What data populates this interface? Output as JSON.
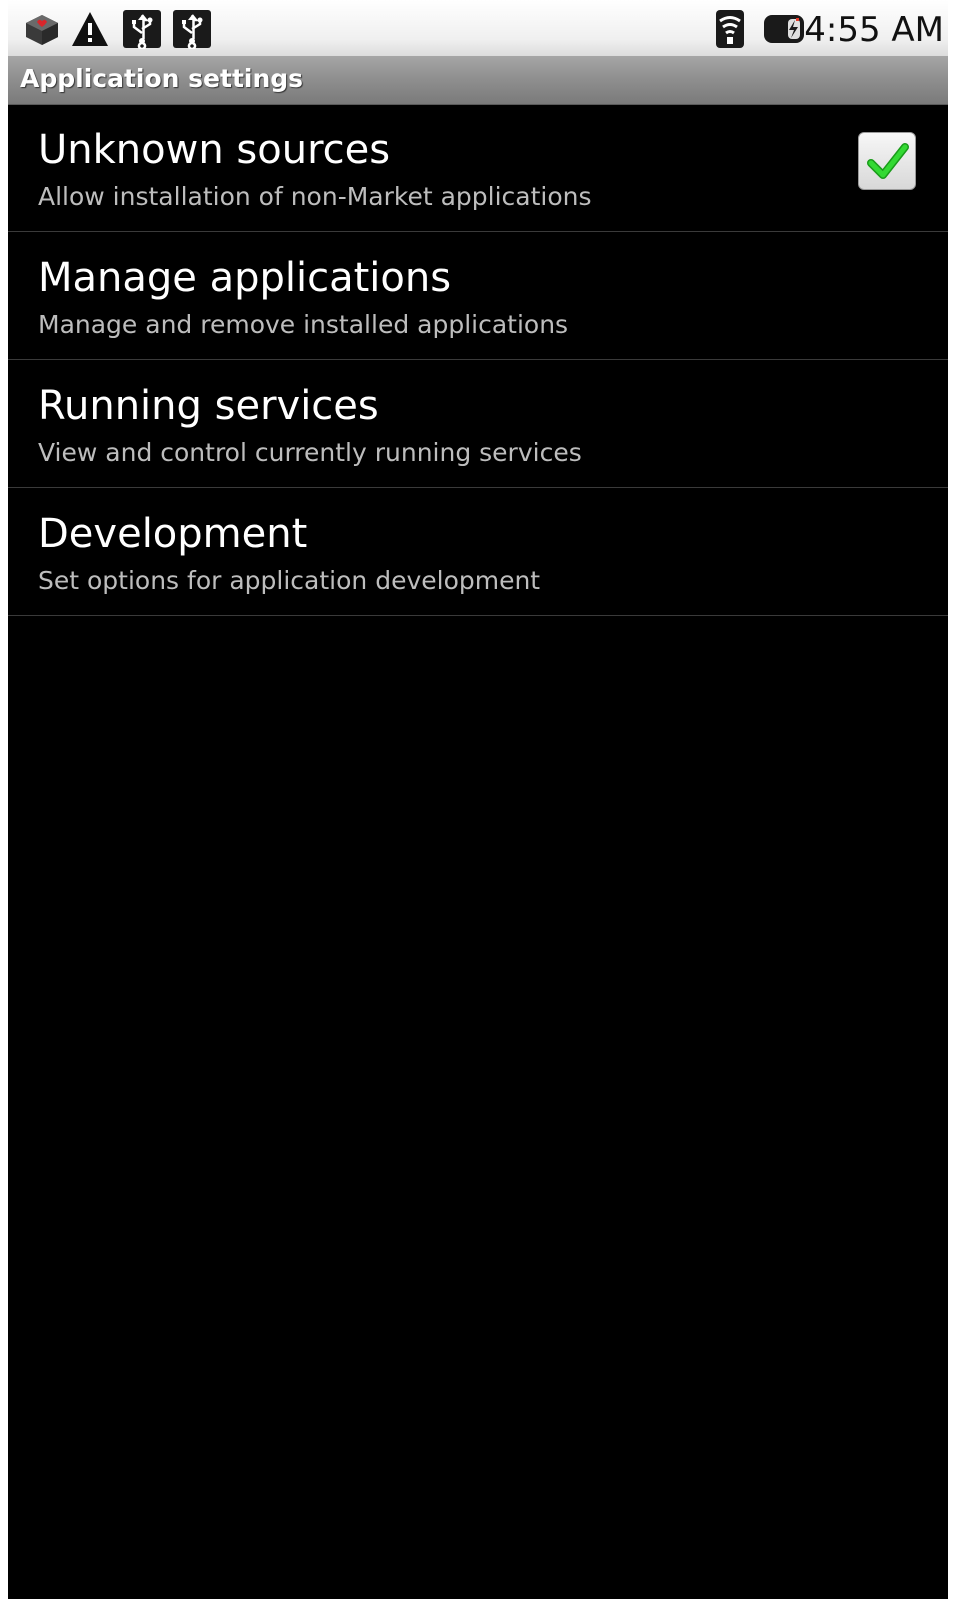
{
  "status_bar": {
    "notification_icons": [
      "market-icon",
      "warning-icon",
      "usb-icon",
      "usb-icon"
    ],
    "system_icons": [
      "wifi-icon",
      "battery-charging-icon"
    ],
    "time": "4:55 AM"
  },
  "title_bar": {
    "title": "Application settings"
  },
  "settings": [
    {
      "title": "Unknown sources",
      "summary": "Allow installation of non-Market applications",
      "checked": true
    },
    {
      "title": "Manage applications",
      "summary": "Manage and remove installed applications"
    },
    {
      "title": "Running services",
      "summary": "View and control currently running services"
    },
    {
      "title": "Development",
      "summary": "Set options for application development"
    }
  ],
  "colors": {
    "background": "#000000",
    "check_green": "#22c722"
  }
}
